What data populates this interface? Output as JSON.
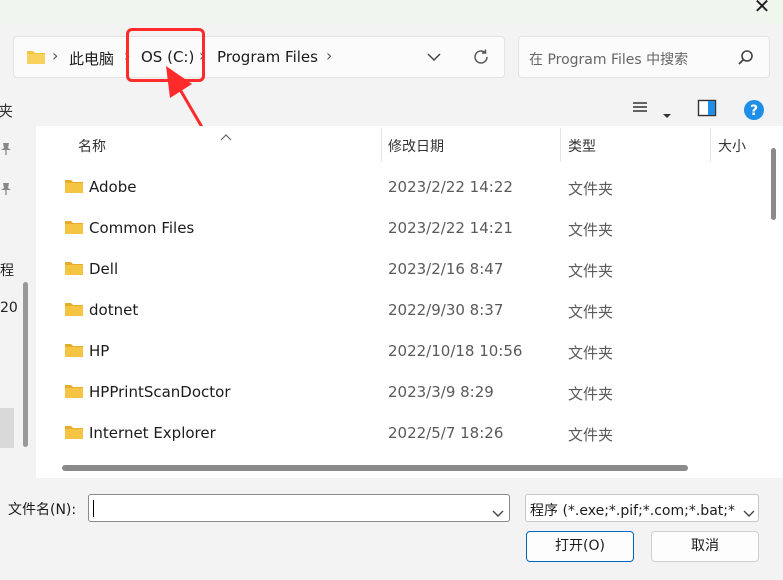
{
  "window": {
    "close_glyph": "✕"
  },
  "address_bar": {
    "crumbs": [
      "此电脑",
      "OS (C:)",
      "Program Files"
    ],
    "separator": "›"
  },
  "search": {
    "placeholder": "在 Program Files 中搜索"
  },
  "toolbar": {
    "left_label": "夹"
  },
  "nav_pane": {
    "labels": [
      "程",
      "20"
    ]
  },
  "file_list": {
    "columns": [
      "名称",
      "修改日期",
      "类型",
      "大小"
    ],
    "rows": [
      {
        "name": "Adobe",
        "date": "2023/2/22 14:22",
        "type": "文件夹"
      },
      {
        "name": "Common Files",
        "date": "2023/2/22 14:21",
        "type": "文件夹"
      },
      {
        "name": "Dell",
        "date": "2023/2/16 8:47",
        "type": "文件夹"
      },
      {
        "name": "dotnet",
        "date": "2022/9/30 8:37",
        "type": "文件夹"
      },
      {
        "name": "HP",
        "date": "2022/10/18 10:56",
        "type": "文件夹"
      },
      {
        "name": "HPPrintScanDoctor",
        "date": "2023/3/9 8:29",
        "type": "文件夹"
      },
      {
        "name": "Internet Explorer",
        "date": "2022/5/7 18:26",
        "type": "文件夹"
      }
    ]
  },
  "footer": {
    "filename_label": "文件名(N):",
    "filename_value": "",
    "filter_value": "程序 (*.exe;*.pif;*.com;*.bat;*",
    "open_label": "打开(O)",
    "cancel_label": "取消"
  },
  "colors": {
    "folder": "#f5c442",
    "accent": "#0067c0",
    "callout": "#ff2b2b",
    "help": "#1e8ee6"
  }
}
